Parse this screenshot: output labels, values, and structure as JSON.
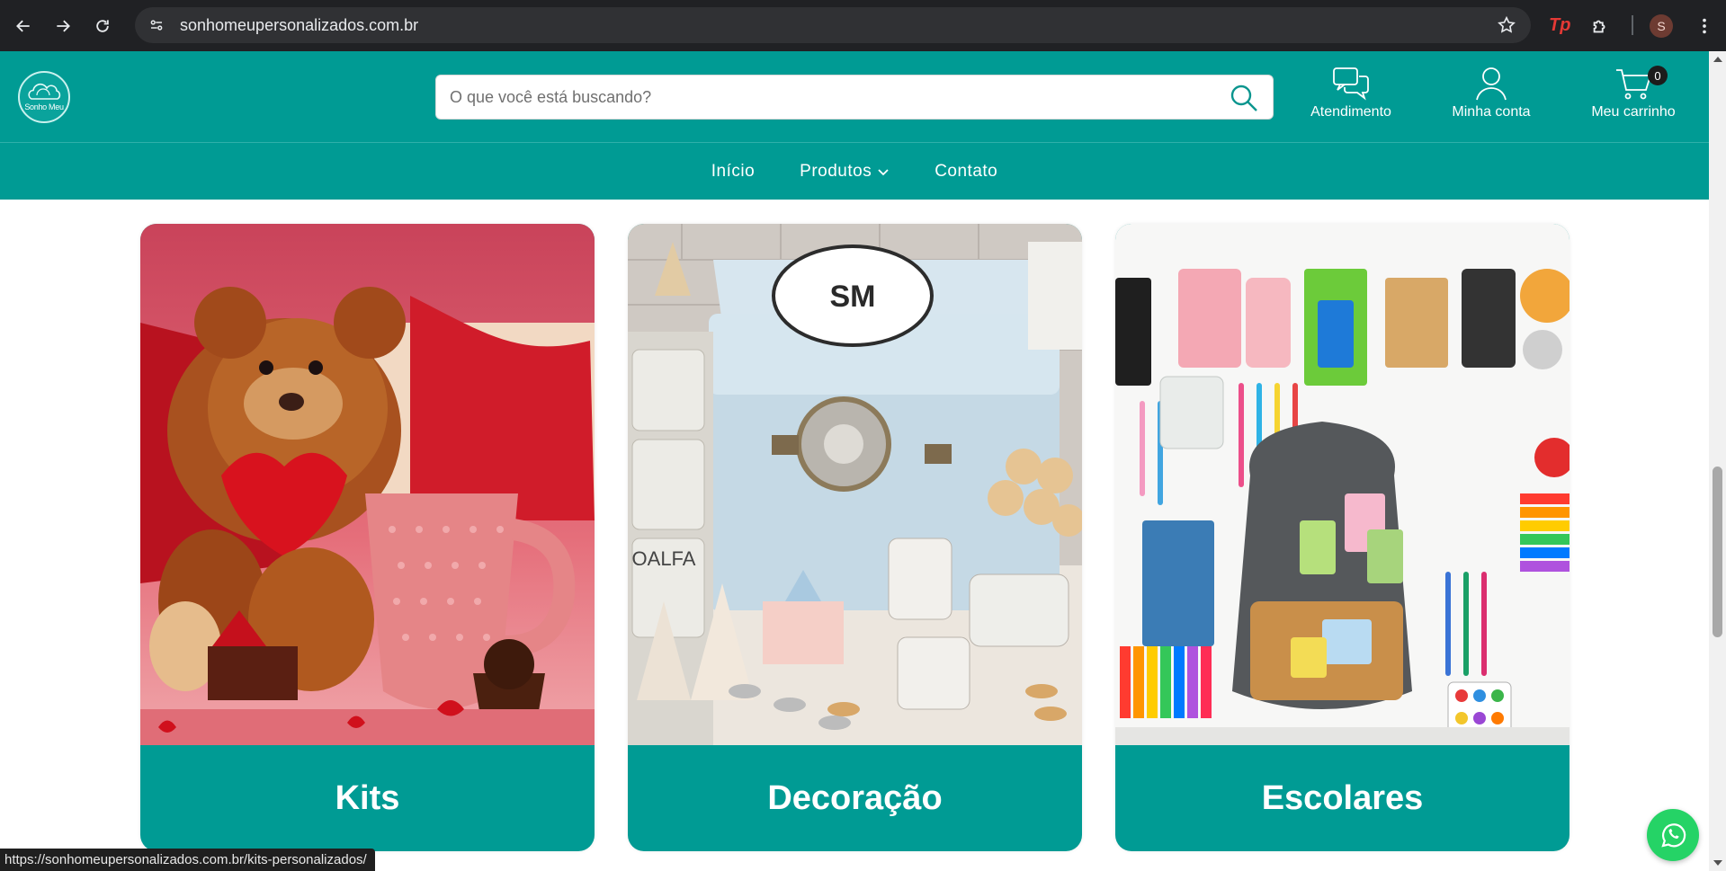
{
  "browser": {
    "url": "sonhomeupersonalizados.com.br",
    "profile_initial": "S",
    "extension_label": "Tp",
    "status_url": "https://sonhomeupersonalizados.com.br/kits-personalizados/"
  },
  "header": {
    "logo_text": "Sonho Meu",
    "search_placeholder": "O que você está buscando?",
    "actions": {
      "support": "Atendimento",
      "account": "Minha conta",
      "cart": "Meu carrinho"
    },
    "cart_count": "0"
  },
  "menu": {
    "home": "Início",
    "products": "Produtos",
    "contact": "Contato"
  },
  "cards": [
    {
      "label": "Kits"
    },
    {
      "label": "Decoração"
    },
    {
      "label": "Escolares"
    }
  ],
  "colors": {
    "brand_teal": "#009b94",
    "whatsapp_green": "#25d366"
  }
}
